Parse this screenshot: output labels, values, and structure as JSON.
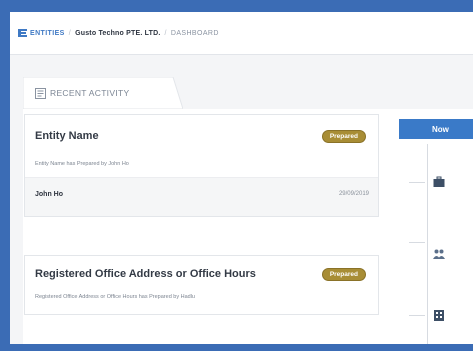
{
  "breadcrumb": {
    "root": "ENTITIES",
    "entity": "Gusto Techno PTE. LTD.",
    "current": "DASHBOARD",
    "separator": "/"
  },
  "tab": {
    "label": "RECENT ACTIVITY",
    "icon": "activity-list-icon"
  },
  "timeline": {
    "now_label": "Now",
    "icons": [
      "briefcase-icon",
      "users-icon",
      "building-icon"
    ]
  },
  "activities": [
    {
      "title": "Entity Name",
      "status": "Prepared",
      "description": "Entity Name has Prepared by John Ho",
      "user": "John Ho",
      "date": "29/09/2019"
    },
    {
      "title": "Registered Office Address or Office Hours",
      "status": "Prepared",
      "description": "Registered Office Address or Office Hours has Prepared by Hadlu"
    }
  ],
  "colors": {
    "frame_background": "#3b6cb5",
    "accent": "#3a7ac8",
    "badge": "#a88d35",
    "timeline_icon": "#3d4f66"
  }
}
